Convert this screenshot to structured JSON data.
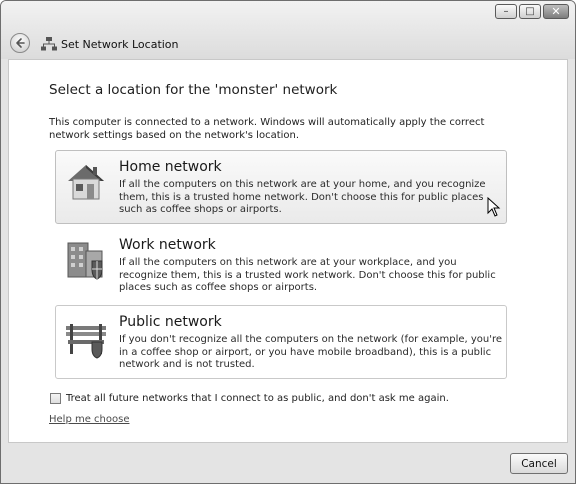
{
  "window": {
    "title": "Set Network Location",
    "controls": {
      "minimize": "–",
      "maximize": "□",
      "close": "✕"
    }
  },
  "content": {
    "heading": "Select a location for the 'monster' network",
    "intro": "This computer is connected to a network. Windows will automatically apply the correct network settings based on the network's location.",
    "options": [
      {
        "title": "Home network",
        "description": "If all the computers on this network are at your home, and you recognize them, this is a trusted home network.  Don't choose this for public places such as coffee shops or airports.",
        "icon": "house-icon"
      },
      {
        "title": "Work network",
        "description": "If all the computers on this network are at your workplace, and you recognize them, this is a trusted work network.  Don't choose this for public places such as coffee shops or airports.",
        "icon": "office-building-icon"
      },
      {
        "title": "Public network",
        "description": "If you don't recognize all the computers on the network (for example, you're in a coffee shop or airport, or you have mobile broadband), this is a public network and is not trusted.",
        "icon": "park-bench-icon"
      }
    ],
    "checkbox_label": "Treat all future networks that I connect to as public, and don't ask me again.",
    "checkbox_checked": false,
    "help_link": "Help me choose"
  },
  "footer": {
    "cancel_label": "Cancel"
  }
}
